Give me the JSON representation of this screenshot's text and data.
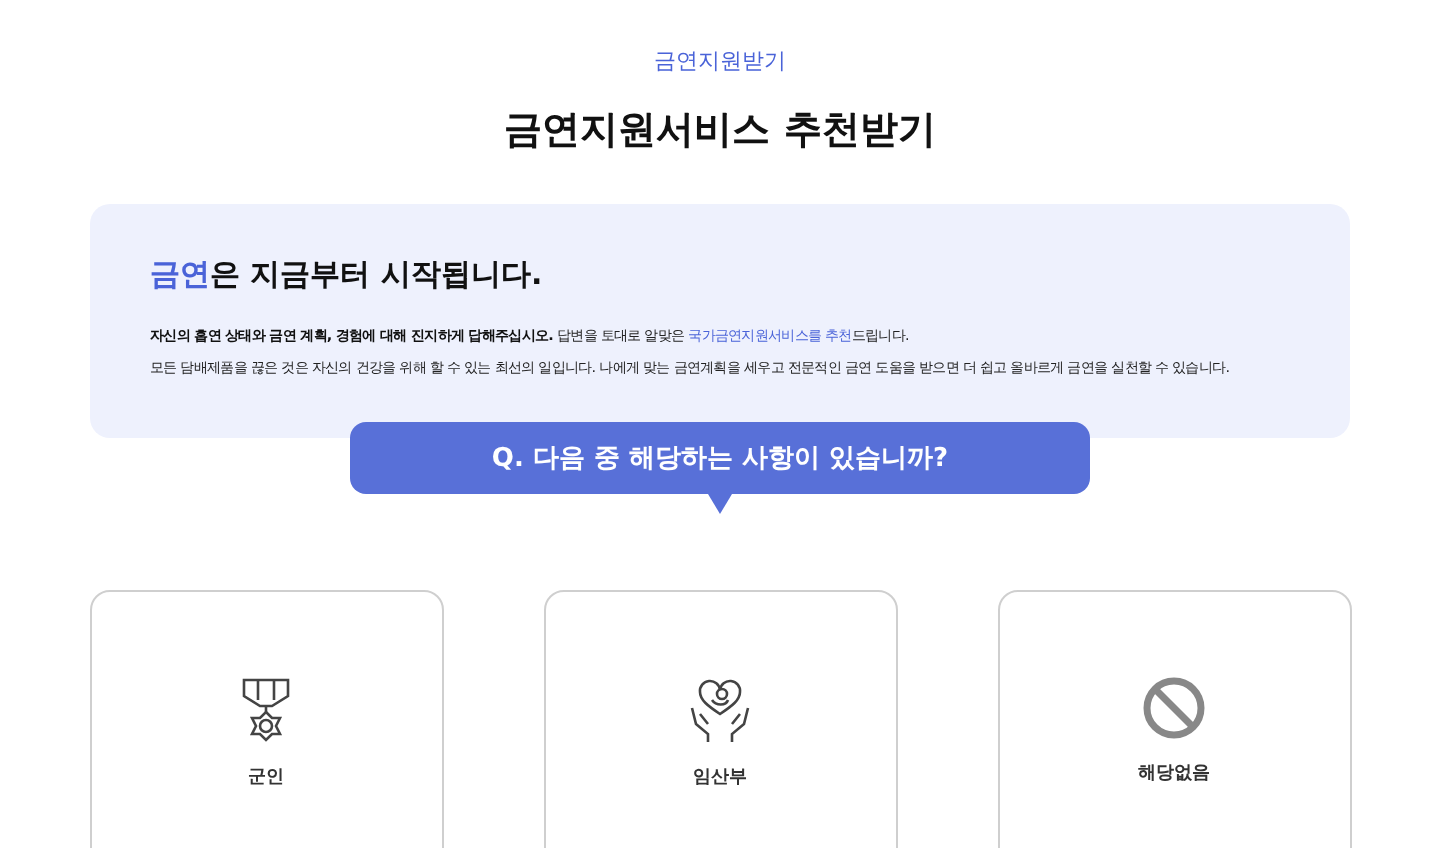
{
  "breadcrumb": "금연지원받기",
  "page_title": "금연지원서비스 추천받기",
  "intro": {
    "headline": [
      {
        "text": "금연",
        "highlight": true
      },
      {
        "text": "은 지금부터 시작됩니다.",
        "highlight": false
      }
    ],
    "paragraphs": [
      [
        {
          "text": "자신의 흡연 상태와 금연 계획, 경험에 대해 진지하게 답해주십시오.",
          "kind": "bold"
        },
        {
          "text": " 답변을 토대로 알맞은 ",
          "kind": "plain"
        },
        {
          "text": "국가금연지원서비스를 추천",
          "kind": "accent"
        },
        {
          "text": "드립니다.",
          "kind": "plain"
        }
      ],
      [
        {
          "text": "모든 담배제품을 끊은 것은 자신의 건강을 위해 할 수 있는 최선의 일입니다. 나에게 맞는 금연계획을 세우고 전문적인 금연 도움을 받으면 더 쉽고 올바르게 금연을 실천할 수 있습니다.",
          "kind": "plain"
        }
      ]
    ]
  },
  "question": "Q. 다음 중 해당하는 사항이 있습니까?",
  "options": [
    {
      "label": "군인",
      "kind": "medal"
    },
    {
      "label": "임산부",
      "kind": "pregnancy"
    },
    {
      "label": "해당없음",
      "kind": "none"
    }
  ]
}
